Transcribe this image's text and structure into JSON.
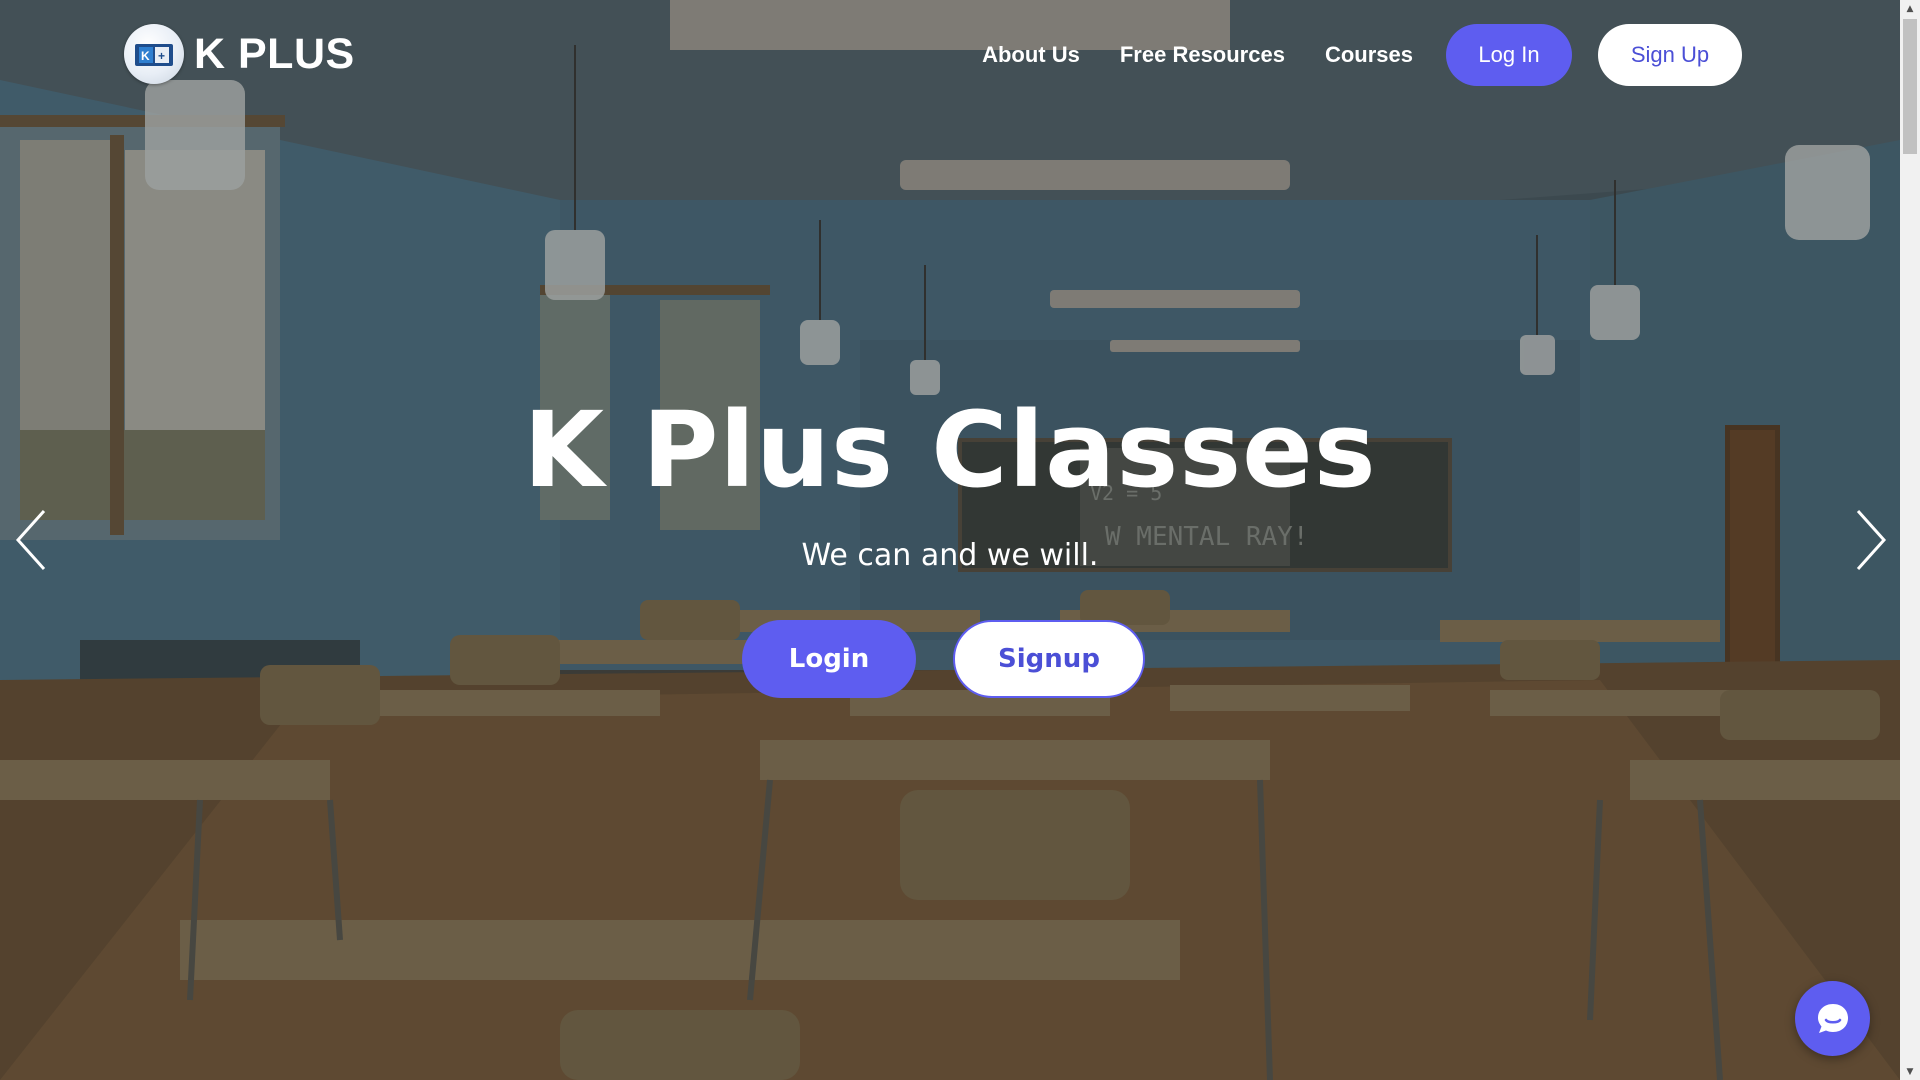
{
  "brand": {
    "name": "K PLUS",
    "logo_icon": "kplus-logo-icon"
  },
  "nav": {
    "links": [
      {
        "label": "About Us"
      },
      {
        "label": "Free Resources"
      },
      {
        "label": "Courses"
      }
    ],
    "login_label": "Log In",
    "signup_label": "Sign Up"
  },
  "hero": {
    "title": "K Plus Classes",
    "subtitle": "We can and we will.",
    "login_label": "Login",
    "signup_label": "Signup",
    "background": "classroom-photo"
  },
  "carousel": {
    "prev_icon": "chevron-left-icon",
    "next_icon": "chevron-right-icon"
  },
  "chat": {
    "icon": "chat-bubble-icon"
  },
  "colors": {
    "accent": "#5e5df0",
    "accent_text": "#4b4fd6",
    "white": "#ffffff"
  }
}
